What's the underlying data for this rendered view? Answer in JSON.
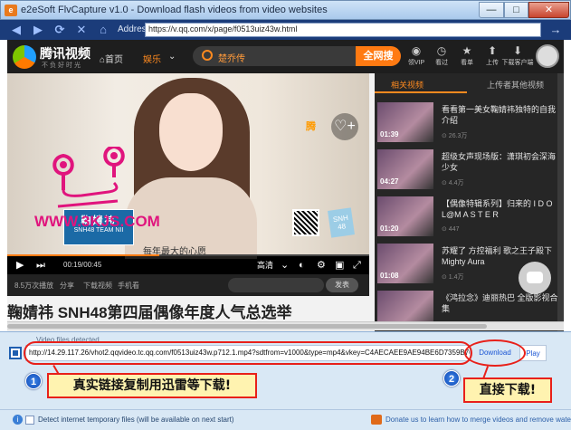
{
  "window": {
    "title": "e2eSoft FlvCapture v1.0 - Download flash videos from video websites",
    "app_icon": "e",
    "min_glyph": "—",
    "max_glyph": "□",
    "close_glyph": "✕"
  },
  "navbar": {
    "back_glyph": "◀",
    "forward_glyph": "▶",
    "refresh_glyph": "⟳",
    "stop_glyph": "✕",
    "home_glyph": "⌂",
    "address_label": "Address:",
    "address_value": "https://v.qq.com/x/page/f0513uiz43w.html",
    "go_glyph": "→"
  },
  "site": {
    "logo_text": "腾讯视频",
    "logo_sub": "不负好时光",
    "nav": [
      {
        "label": "⌂首页",
        "active": false
      },
      {
        "label": "娱乐",
        "active": true
      },
      {
        "label": "⌄",
        "active": false
      }
    ],
    "search_text": "楚乔传",
    "search_button": "全网搜",
    "header_icons": [
      {
        "glyph": "◉",
        "label": "领VIP"
      },
      {
        "glyph": "◷",
        "label": "看过"
      },
      {
        "glyph": "★",
        "label": "看单"
      },
      {
        "glyph": "⬆",
        "label": "上传"
      },
      {
        "glyph": "⬇",
        "label": "下载客户端"
      }
    ]
  },
  "player": {
    "qq_logo": "腾",
    "favorite_glyph": "♡+",
    "name_card_title": "鞠婧祎",
    "name_card_sub": "SNH48 TEAM NII",
    "snh_badge": "SNH 48",
    "subtitle": "每年最大的心愿",
    "time": "00:19/00:45",
    "progress": 0.42,
    "quality": "高清",
    "play_glyph": "▶",
    "next_glyph": "⏭",
    "controls": [
      "⌄",
      "◐",
      "⚙",
      "▣",
      "⤢"
    ]
  },
  "below_player": {
    "items": [
      "8.5万次播放",
      "分享",
      "下载视频",
      "手机看"
    ],
    "send_label": "发表",
    "page_title": "鞠婧祎 SNH48第四届偶像年度人气总选举"
  },
  "sidebar": {
    "tabs": [
      "相关视频",
      "上传者其他视频"
    ],
    "items": [
      {
        "title": "看看第一美女鞠婧祎独特的自我介绍",
        "duration": "01:39",
        "views": "⊙ 26.3万"
      },
      {
        "title": "超级女声现场版：潇琪初会深海少女",
        "duration": "04:27",
        "views": "⊙ 4.4万"
      },
      {
        "title": "【偶像特辑系列】归来的 I D O L@M A S T E R",
        "duration": "01:20",
        "views": "⊙ 447"
      },
      {
        "title": "苏耀了 方控福利 歌之王子殿下 Mighty Aura",
        "duration": "01:08",
        "views": "⊙ 1.4万"
      },
      {
        "title": "《鸿拉念》迪丽热巴 全版影视合集",
        "duration": "",
        "views": ""
      }
    ]
  },
  "watermark": {
    "text": "WWW.3KJS.COM",
    "color": "#e0147d"
  },
  "panel": {
    "detected_label": "Video files detected",
    "url": "http://14.29.117.26/vhot2.qqvideo.tc.qq.com/f0513uiz43w.p712.1.mp4?sdtfrom=v1000&type=mp4&vkey=C4AECAEE9AE94BE6D7359B763BCF980402...",
    "download_label": "Download",
    "play_label": "Play",
    "callout_1_num": "1",
    "callout_1_text": "真实链接复制用迅雷等下载!",
    "callout_2_num": "2",
    "callout_2_text": "直接下载!",
    "status_checkbox_label": "Detect internet temporary files (will be available on next start)",
    "status_right": "Donate us to learn how to merge videos and remove watermarks!"
  },
  "colors": {
    "accent_orange": "#ff7a12",
    "annotation_red": "#e8201a",
    "link_blue": "#1a55d4",
    "titlebar": "#a9c9ec",
    "navbar": "#1b3c7a"
  }
}
